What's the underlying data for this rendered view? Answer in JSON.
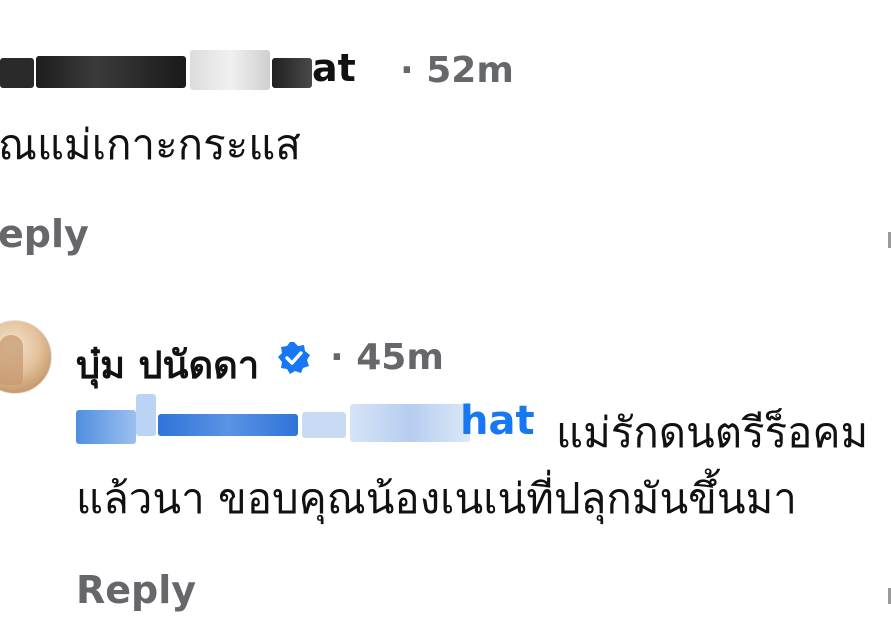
{
  "comment1": {
    "author_visible_start": "",
    "author_visible_end": "at",
    "separator": "·",
    "time": "52m",
    "text": "ณแม่เกาะกระแส",
    "reply_label": "eply"
  },
  "comment2": {
    "author": "บุ๋ม ปนัดดา",
    "separator": "·",
    "time": "45m",
    "mention_visible_end": "hat",
    "text_line1": "แม่รักดนตรีร็อคม",
    "text_line2": "แล้วนา ขอบคุณน้องเนเน่ที่ปลุกมันขึ้นมา",
    "reply_label": "Reply"
  },
  "colors": {
    "name_text": "#111111",
    "meta_text": "#65676b",
    "mention_blue": "#1877f2",
    "verified_blue": "#1877f2"
  },
  "icons": {
    "verified": "verified-badge-icon",
    "avatar": "profile-photo"
  }
}
